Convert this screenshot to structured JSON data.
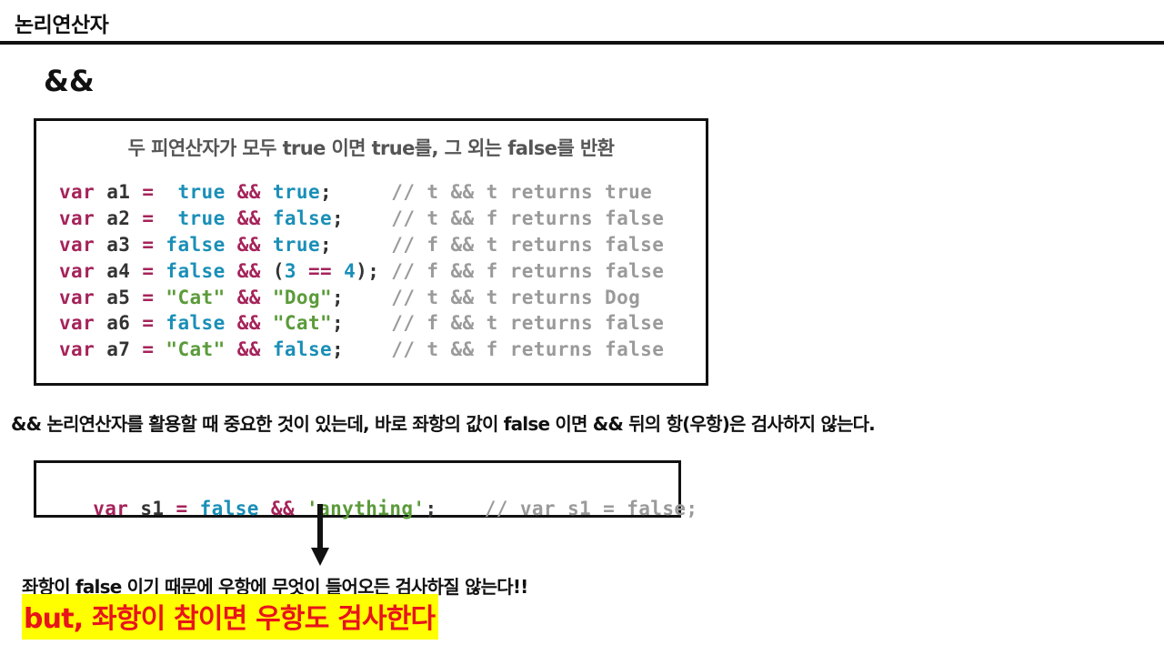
{
  "header": {
    "title": "논리연산자"
  },
  "operator_title": "&&",
  "box1": {
    "description": "두 피연산자가 모두 true 이면 true를, 그 외는 false를 반환",
    "lines": [
      {
        "kw": "var",
        "name": "a1",
        "eq": "=",
        "left": " true",
        "left_type": "bool",
        "op": "&&",
        "right": "true",
        "right_type": "bool",
        "tail": ";",
        "pad": "     ",
        "comment": "// t && t returns true"
      },
      {
        "kw": "var",
        "name": "a2",
        "eq": "=",
        "left": " true",
        "left_type": "bool",
        "op": "&&",
        "right": "false",
        "right_type": "bool",
        "tail": ";",
        "pad": "    ",
        "comment": "// t && f returns false"
      },
      {
        "kw": "var",
        "name": "a3",
        "eq": "=",
        "left": "false",
        "left_type": "bool",
        "op": "&&",
        "right": "true",
        "right_type": "bool",
        "tail": ";",
        "pad": "     ",
        "comment": "// f && t returns false"
      },
      {
        "kw": "var",
        "name": "a4",
        "eq": "=",
        "left": "false",
        "left_type": "bool",
        "op": "&&",
        "right_parts": [
          {
            "t": "(",
            "c": "pn"
          },
          {
            "t": "3",
            "c": "num"
          },
          {
            "t": " == ",
            "c": "op"
          },
          {
            "t": "4",
            "c": "num"
          },
          {
            "t": ")",
            "c": "pn"
          }
        ],
        "tail": ";",
        "pad": " ",
        "comment": "// f && f returns false"
      },
      {
        "kw": "var",
        "name": "a5",
        "eq": "=",
        "left": "\"Cat\"",
        "left_type": "str",
        "op": "&&",
        "right": "\"Dog\"",
        "right_type": "str",
        "tail": ";",
        "pad": "    ",
        "comment": "// t && t returns Dog"
      },
      {
        "kw": "var",
        "name": "a6",
        "eq": "=",
        "left": "false",
        "left_type": "bool",
        "op": "&&",
        "right": "\"Cat\"",
        "right_type": "str",
        "tail": ";",
        "pad": "    ",
        "comment": "// f && t returns false"
      },
      {
        "kw": "var",
        "name": "a7",
        "eq": "=",
        "left": "\"Cat\"",
        "left_type": "str",
        "op": "&&",
        "right": "false",
        "right_type": "bool",
        "tail": ";",
        "pad": "    ",
        "comment": "// t && f returns false"
      }
    ]
  },
  "note1": "&& 논리연산자를 활용할 때 중요한 것이 있는데, 바로 좌항의 값이 false 이면 && 뒤의 항(우항)은 검사하지 않는다.",
  "box2": {
    "kw": "var",
    "name": "s1",
    "eq": "=",
    "left": "false",
    "op": "&&",
    "right": "'anything'",
    "tail": ";",
    "pad": "    ",
    "comment": "// var s1 = false;"
  },
  "note2": "좌항이 false 이기 때문에 우항에 무엇이 들어오든 검사하질 않는다!!",
  "note3": "but, 좌항이 참이면 우항도 검사한다",
  "colors": {
    "keyword": "#a5235a",
    "boolean": "#1a8fb7",
    "string": "#5b9b3a",
    "comment": "#9a9a9a",
    "highlight": "#ffff00",
    "emphasis_text": "#e8141b"
  }
}
